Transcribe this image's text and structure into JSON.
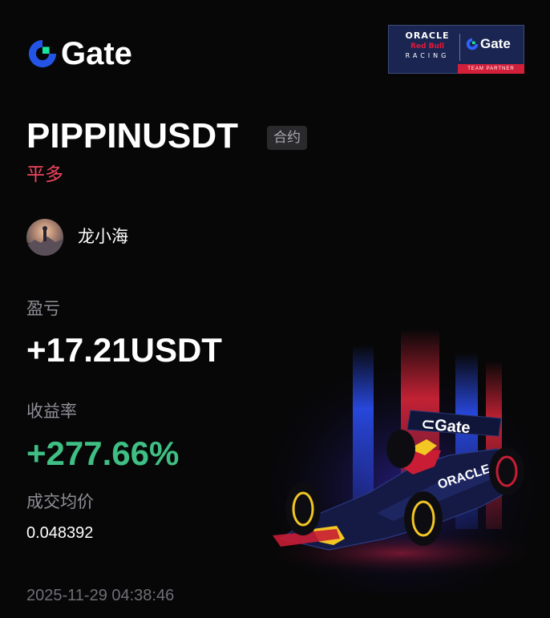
{
  "brand": {
    "name": "Gate"
  },
  "partner": {
    "oracle": "ORACLE",
    "red_bull": "Red Bull",
    "racing": "RACING",
    "gate": "Gate",
    "badge": "TEAM PARTNER"
  },
  "position": {
    "pair": "PIPPINUSDT",
    "tag": "合约",
    "side": "平多"
  },
  "user": {
    "name": "龙小海"
  },
  "stats": {
    "pnl_label": "盈亏",
    "pnl_value": "+17.21USDT",
    "roi_label": "收益率",
    "roi_value": "+277.66%",
    "avg_price_label": "成交均价",
    "avg_price_value": "0.048392"
  },
  "timestamp": "2025-11-29 04:38:46",
  "colors": {
    "brand_blue": "#2354e6",
    "brand_green": "#17e6a1",
    "loss_red": "#f0455d",
    "gain_green": "#3fbf83"
  },
  "icons": {
    "logo": "gate-logo-icon",
    "car": "race-car-illustration"
  }
}
